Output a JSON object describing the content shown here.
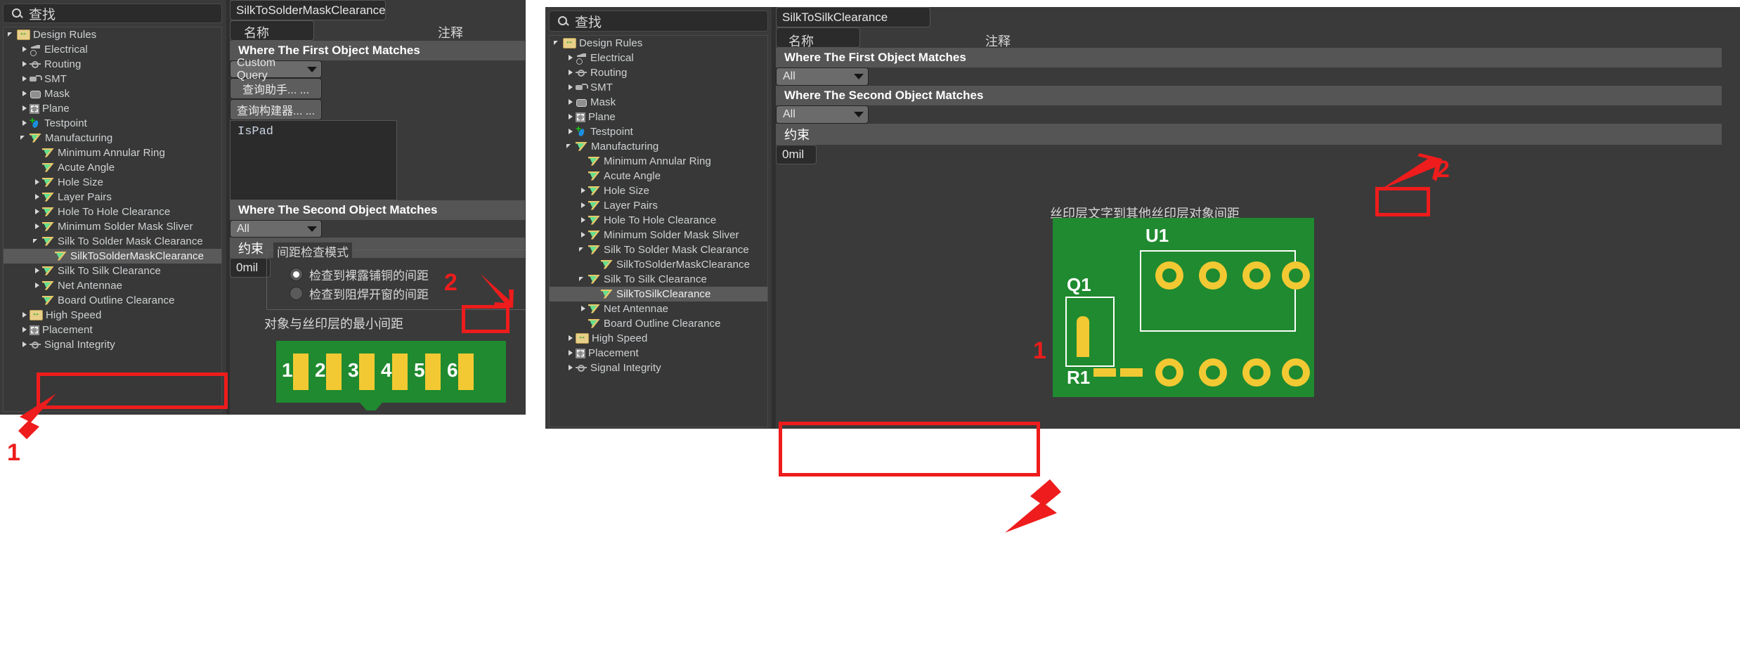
{
  "search": {
    "placeholder": "查找",
    "icon": "search-icon"
  },
  "tree_left": {
    "items": [
      {
        "label": "Design Rules",
        "indent": 0,
        "expander": "open",
        "icon": "folder-icon"
      },
      {
        "label": "Electrical",
        "indent": 1,
        "expander": "closed",
        "icon": "electrical-icon"
      },
      {
        "label": "Routing",
        "indent": 1,
        "expander": "closed",
        "icon": "routing-icon"
      },
      {
        "label": "SMT",
        "indent": 1,
        "expander": "closed",
        "icon": "smt-icon"
      },
      {
        "label": "Mask",
        "indent": 1,
        "expander": "closed",
        "icon": "mask-icon"
      },
      {
        "label": "Plane",
        "indent": 1,
        "expander": "closed",
        "icon": "plane-icon"
      },
      {
        "label": "Testpoint",
        "indent": 1,
        "expander": "closed",
        "icon": "testpoint-icon"
      },
      {
        "label": "Manufacturing",
        "indent": 1,
        "expander": "open",
        "icon": "rule-flag-icon"
      },
      {
        "label": "Minimum Annular Ring",
        "indent": 2,
        "expander": "none",
        "icon": "rule-flag-icon"
      },
      {
        "label": "Acute Angle",
        "indent": 2,
        "expander": "none",
        "icon": "rule-flag-icon"
      },
      {
        "label": "Hole Size",
        "indent": 2,
        "expander": "closed",
        "icon": "rule-flag-icon"
      },
      {
        "label": "Layer Pairs",
        "indent": 2,
        "expander": "closed",
        "icon": "rule-flag-icon"
      },
      {
        "label": "Hole To Hole Clearance",
        "indent": 2,
        "expander": "closed",
        "icon": "rule-flag-icon"
      },
      {
        "label": "Minimum Solder Mask Sliver",
        "indent": 2,
        "expander": "closed",
        "icon": "rule-flag-icon"
      },
      {
        "label": "Silk To Solder Mask Clearance",
        "indent": 2,
        "expander": "open",
        "icon": "rule-flag-icon"
      },
      {
        "label": "SilkToSolderMaskClearance",
        "indent": 3,
        "expander": "none",
        "icon": "rule-flag-icon",
        "selected": true
      },
      {
        "label": "Silk To Silk Clearance",
        "indent": 2,
        "expander": "closed",
        "icon": "rule-flag-icon"
      },
      {
        "label": "Net Antennae",
        "indent": 2,
        "expander": "closed",
        "icon": "rule-flag-icon"
      },
      {
        "label": "Board Outline Clearance",
        "indent": 2,
        "expander": "none",
        "icon": "rule-flag-icon"
      },
      {
        "label": "High Speed",
        "indent": 1,
        "expander": "closed",
        "icon": "folder-icon"
      },
      {
        "label": "Placement",
        "indent": 1,
        "expander": "closed",
        "icon": "placement-icon"
      },
      {
        "label": "Signal Integrity",
        "indent": 1,
        "expander": "closed",
        "icon": "signal-icon"
      }
    ]
  },
  "form_left": {
    "name_label": "名称",
    "name_value": "SilkToSolderMaskClearance",
    "comment_label": "注释",
    "comment_value": "",
    "first_object_header": "Where The First Object Matches",
    "first_object_scope": "Custom Query",
    "query_value": "IsPad",
    "query_helper_button": "查询助手... ...",
    "query_builder_button": "查询构建器... ...",
    "second_object_header": "Where The Second Object Matches",
    "second_object_scope": "All",
    "constraint_header": "约束",
    "group_title": "间距检查模式",
    "radio_1": "检查到裸露铺铜的间距",
    "radio_2": "检查到阻焊开窗的间距",
    "radio_selected_index": 0,
    "min_clearance_label": "对象与丝印层的最小间距",
    "min_clearance_value": "0mil",
    "pcb_numbers": [
      "1",
      "2",
      "3",
      "4",
      "5",
      "6"
    ]
  },
  "tree_right": {
    "items": [
      {
        "label": "Design Rules",
        "indent": 0,
        "expander": "open",
        "icon": "folder-icon"
      },
      {
        "label": "Electrical",
        "indent": 1,
        "expander": "closed",
        "icon": "electrical-icon"
      },
      {
        "label": "Routing",
        "indent": 1,
        "expander": "closed",
        "icon": "routing-icon"
      },
      {
        "label": "SMT",
        "indent": 1,
        "expander": "closed",
        "icon": "smt-icon"
      },
      {
        "label": "Mask",
        "indent": 1,
        "expander": "closed",
        "icon": "mask-icon"
      },
      {
        "label": "Plane",
        "indent": 1,
        "expander": "closed",
        "icon": "plane-icon"
      },
      {
        "label": "Testpoint",
        "indent": 1,
        "expander": "closed",
        "icon": "testpoint-icon"
      },
      {
        "label": "Manufacturing",
        "indent": 1,
        "expander": "open",
        "icon": "rule-flag-icon"
      },
      {
        "label": "Minimum Annular Ring",
        "indent": 2,
        "expander": "none",
        "icon": "rule-flag-icon"
      },
      {
        "label": "Acute Angle",
        "indent": 2,
        "expander": "none",
        "icon": "rule-flag-icon"
      },
      {
        "label": "Hole Size",
        "indent": 2,
        "expander": "closed",
        "icon": "rule-flag-icon"
      },
      {
        "label": "Layer Pairs",
        "indent": 2,
        "expander": "closed",
        "icon": "rule-flag-icon"
      },
      {
        "label": "Hole To Hole Clearance",
        "indent": 2,
        "expander": "closed",
        "icon": "rule-flag-icon"
      },
      {
        "label": "Minimum Solder Mask Sliver",
        "indent": 2,
        "expander": "closed",
        "icon": "rule-flag-icon"
      },
      {
        "label": "Silk To Solder Mask Clearance",
        "indent": 2,
        "expander": "open",
        "icon": "rule-flag-icon"
      },
      {
        "label": "SilkToSolderMaskClearance",
        "indent": 3,
        "expander": "none",
        "icon": "rule-flag-icon"
      },
      {
        "label": "Silk To Silk Clearance",
        "indent": 2,
        "expander": "open",
        "icon": "rule-flag-icon"
      },
      {
        "label": "SilkToSilkClearance",
        "indent": 3,
        "expander": "none",
        "icon": "rule-flag-icon",
        "selected": true
      },
      {
        "label": "Net Antennae",
        "indent": 2,
        "expander": "closed",
        "icon": "rule-flag-icon"
      },
      {
        "label": "Board Outline Clearance",
        "indent": 2,
        "expander": "none",
        "icon": "rule-flag-icon"
      },
      {
        "label": "High Speed",
        "indent": 1,
        "expander": "closed",
        "icon": "folder-icon"
      },
      {
        "label": "Placement",
        "indent": 1,
        "expander": "closed",
        "icon": "placement-icon"
      },
      {
        "label": "Signal Integrity",
        "indent": 1,
        "expander": "closed",
        "icon": "signal-icon"
      }
    ]
  },
  "form_right": {
    "name_label": "名称",
    "name_value": "SilkToSilkClearance",
    "comment_label": "注释",
    "comment_value": "",
    "first_object_header": "Where The First Object Matches",
    "first_object_scope": "All",
    "second_object_header": "Where The Second Object Matches",
    "second_object_scope": "All",
    "constraint_header": "约束",
    "min_clearance_label": "丝印层文字到其他丝印层对象间距",
    "min_clearance_value": "0mil",
    "pcb_refdes": [
      "U1",
      "Q1",
      "R1"
    ]
  },
  "annotations": {
    "left_marker_1": "1",
    "left_marker_2": "2",
    "right_marker_1": "1",
    "right_marker_2": "2",
    "accent_color": "#ee1c1c"
  }
}
